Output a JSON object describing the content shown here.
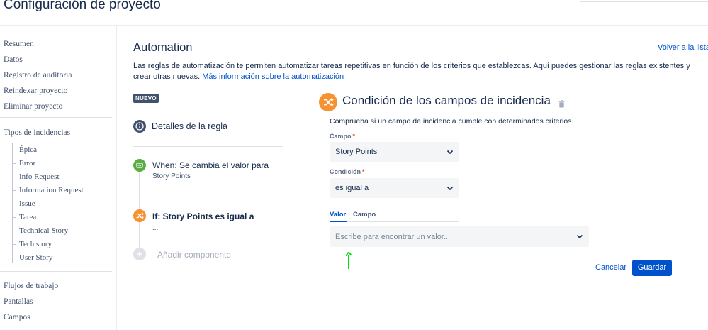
{
  "header": {
    "title": "Configuración de proyecto"
  },
  "sidebar": {
    "top_items": [
      "Resumen",
      "Datos",
      "Registro de auditoría",
      "Reindexar proyecto",
      "Eliminar proyecto"
    ],
    "issue_types_heading": "Tipos de incidencias",
    "issue_types": [
      "Épica",
      "Error",
      "Info Request",
      "Information Request",
      "Issue",
      "Tarea",
      "Technical Story",
      "Tech story",
      "User Story"
    ],
    "bottom_items": [
      "Flujos de trabajo",
      "Pantallas",
      "Campos"
    ]
  },
  "main": {
    "title": "Automation",
    "back_link": "Volver a la lista",
    "description": "Las reglas de automatización te permiten automatizar tareas repetitivas en función de los criterios que establezcas. Aquí puedes gestionar las reglas existentes y crear otras nuevas.",
    "more_link": "Más información sobre la automatización",
    "badge": "NUEVO"
  },
  "rule": {
    "details_label": "Detalles de la regla",
    "trigger_label": "When: Se cambia el valor para",
    "trigger_sub": "Story Points",
    "condition_label": "If: Story Points es igual a",
    "condition_sub": "...",
    "add_component": "Añadir componente"
  },
  "panel": {
    "title": "Condición de los campos de incidencia",
    "description": "Comprueba si un campo de incidencia cumple con determinados criterios.",
    "field_label": "Campo",
    "field_value": "Story Points",
    "condition_label": "Condición",
    "condition_value": "es igual a",
    "tab_value": "Valor",
    "tab_field": "Campo",
    "value_placeholder": "Escribe para encontrar un valor...",
    "required_mark": "*",
    "cancel": "Cancelar",
    "save": "Guardar"
  },
  "colors": {
    "accent": "#0052cc",
    "trigger_green": "#5aac44",
    "condition_orange": "#f79232",
    "info_blue": "#42526e",
    "cursor_green": "#00e000"
  },
  "icons": {
    "details": "info-icon",
    "trigger": "trigger-icon",
    "condition": "shuffle-icon",
    "add": "plus-icon",
    "delete": "trash-icon",
    "dropdown": "chevron-down-icon"
  }
}
